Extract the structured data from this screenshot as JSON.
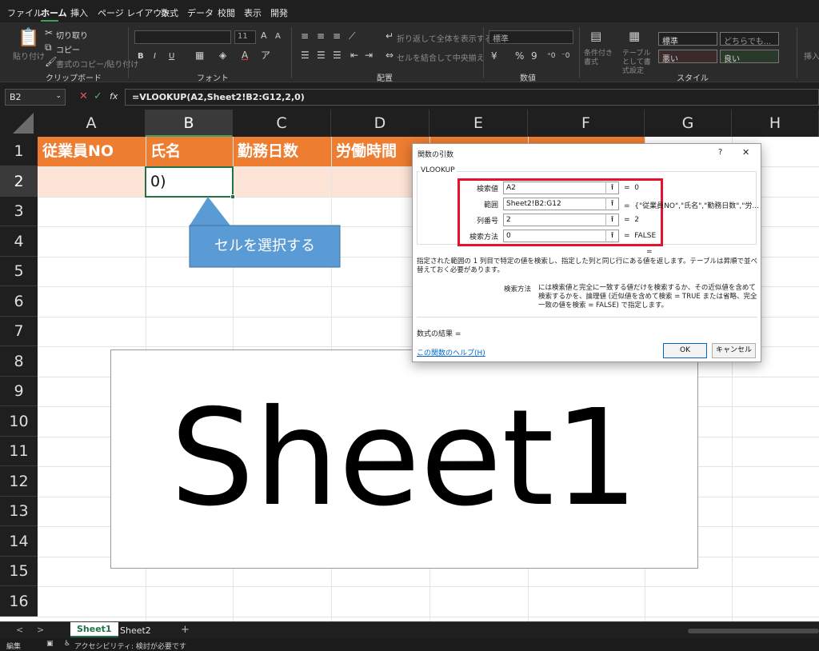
{
  "menu": {
    "tabs": [
      "ファイル",
      "ホーム",
      "挿入",
      "ページ レイアウト",
      "数式",
      "データ",
      "校閲",
      "表示",
      "開発"
    ]
  },
  "ribbon": {
    "clipboard": {
      "paste": "貼り付け",
      "cut": "切り取り",
      "copy": "コピー",
      "format_painter": "書式のコピー/貼り付け",
      "label": "クリップボード"
    },
    "font": {
      "size": "11",
      "bold": "B",
      "italic": "I",
      "underline": "U",
      "label": "フォント"
    },
    "alignment": {
      "wrap_text": "折り返して全体を表示する",
      "merge_center": "セルを結合して中央揃え",
      "label": "配置"
    },
    "number": {
      "format": "標準",
      "percent": "%",
      "comma": "9",
      "label": "数値"
    },
    "styles": {
      "conditional": "条件付き書式",
      "table": "テーブルとして書式設定",
      "normal": "標準",
      "neutral": "どちらでも...",
      "bad": "悪い",
      "good": "良い",
      "label": "スタイル"
    },
    "insert": "挿入"
  },
  "formula_bar": {
    "name_box": "B2",
    "cancel": "✕",
    "enter": "✓",
    "fx": "fx",
    "formula": "=VLOOKUP(A2,Sheet2!B2:G12,2,0)"
  },
  "grid": {
    "columns": [
      "A",
      "B",
      "C",
      "D",
      "E",
      "F",
      "G",
      "H"
    ],
    "rows": [
      "1",
      "2",
      "3",
      "4",
      "5",
      "6",
      "7",
      "8",
      "9",
      "10",
      "11",
      "12",
      "13",
      "14",
      "15",
      "16"
    ],
    "headers": [
      "従業員NO",
      "氏名",
      "勤務日数",
      "労働時間"
    ],
    "active_cell_text": "0)",
    "header_color": "#ED7D31",
    "row2_color": "#FCE4D6"
  },
  "callout": {
    "text": "セルを選択する",
    "color": "#5B9BD5"
  },
  "watermark": {
    "text": "Sheet1"
  },
  "dialog": {
    "title": "関数の引数",
    "help_mark": "?",
    "close": "✕",
    "function_name": "VLOOKUP",
    "args": [
      {
        "label": "検索値",
        "value": "A2",
        "result": "0"
      },
      {
        "label": "範囲",
        "value": "Sheet2!B2:G12",
        "result": "{\"従業員NO\",\"氏名\",\"勤務日数\",\"労..."
      },
      {
        "label": "列番号",
        "value": "2",
        "result": "2"
      },
      {
        "label": "検索方法",
        "value": "0",
        "result": "FALSE"
      }
    ],
    "equals": "=",
    "description": "指定された範囲の 1 列目で特定の値を検索し、指定した列と同じ行にある値を返します。テーブルは昇順で並べ替えておく必要があります。",
    "param_name": "検索方法",
    "param_description": "には検索値と完全に一致する値だけを検索するか、その近似値を含めて検索するかを、論理値 (近似値を含めて検索 = TRUE または省略、完全一致の値を検索 = FALSE) で指定します。",
    "result_label": "数式の結果 =",
    "help_link": "この関数のヘルプ(H)",
    "ok": "OK",
    "cancel": "キャンセル",
    "highlight_color": "#E8112D"
  },
  "sheet_tabs": {
    "tabs": [
      "Sheet1",
      "Sheet2"
    ],
    "add": "+",
    "prev": "<",
    "next": ">"
  },
  "status": {
    "mode": "編集",
    "accessibility": "アクセシビリティ: 検討が必要です"
  }
}
